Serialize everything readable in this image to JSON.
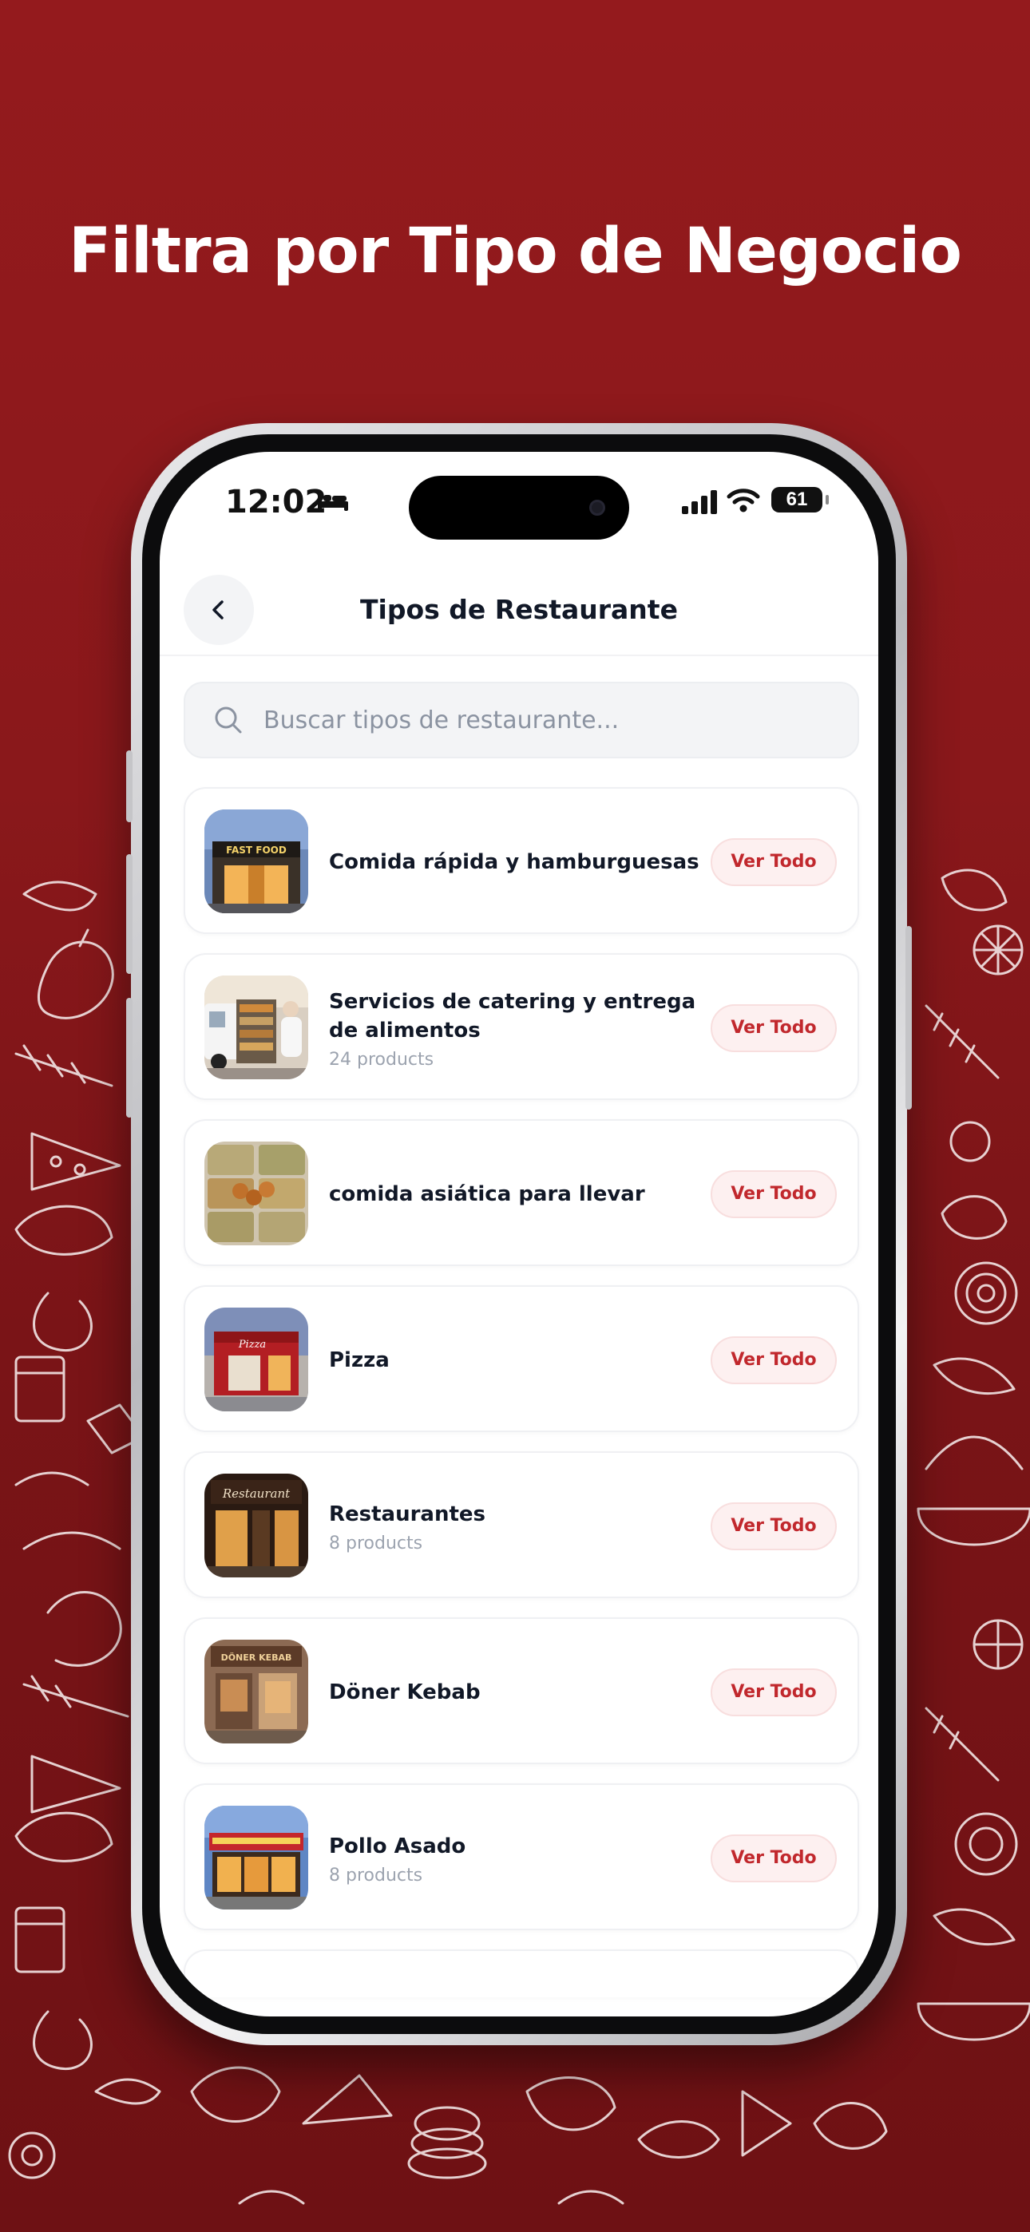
{
  "headline": "Filtra por Tipo de Negocio",
  "colors": {
    "background_top": "#941a1d",
    "background_bottom": "#6e1114",
    "accent": "#c1282d",
    "accent_soft": "#fdf0f0"
  },
  "status_bar": {
    "time": "12:02",
    "battery": "61",
    "icons": [
      "bed-icon",
      "signal-icon",
      "wifi-icon",
      "battery-icon"
    ]
  },
  "header": {
    "title": "Tipos de Restaurante",
    "back_icon": "chevron-left-icon"
  },
  "search": {
    "placeholder": "Buscar tipos de restaurante...",
    "value": "",
    "icon": "search-icon"
  },
  "list": {
    "items": [
      {
        "title": "Comida rápida y hamburguesas",
        "subtitle": "",
        "button": "Ver Todo",
        "image": "fast-food-storefront"
      },
      {
        "title": "Servicios de catering y entrega de alimentos",
        "subtitle": "24 products",
        "button": "Ver Todo",
        "image": "catering-van"
      },
      {
        "title": "comida asiática para llevar",
        "subtitle": "",
        "button": "Ver Todo",
        "image": "asian-takeaway-food"
      },
      {
        "title": "Pizza",
        "subtitle": "",
        "button": "Ver Todo",
        "image": "pizza-storefront"
      },
      {
        "title": "Restaurantes",
        "subtitle": "8 products",
        "button": "Ver Todo",
        "image": "restaurant-storefront"
      },
      {
        "title": "Döner Kebab",
        "subtitle": "",
        "button": "Ver Todo",
        "image": "doner-kebab-storefront"
      },
      {
        "title": "Pollo Asado",
        "subtitle": "8 products",
        "button": "Ver Todo",
        "image": "grilled-chicken-storefront"
      }
    ]
  },
  "thumb_text": {
    "fast_food_sign": "FAST FOOD",
    "pizza_sign": "Pizza",
    "restaurant_sign": "Restaurant",
    "doner_sign": "DÖNER KEBAB"
  }
}
